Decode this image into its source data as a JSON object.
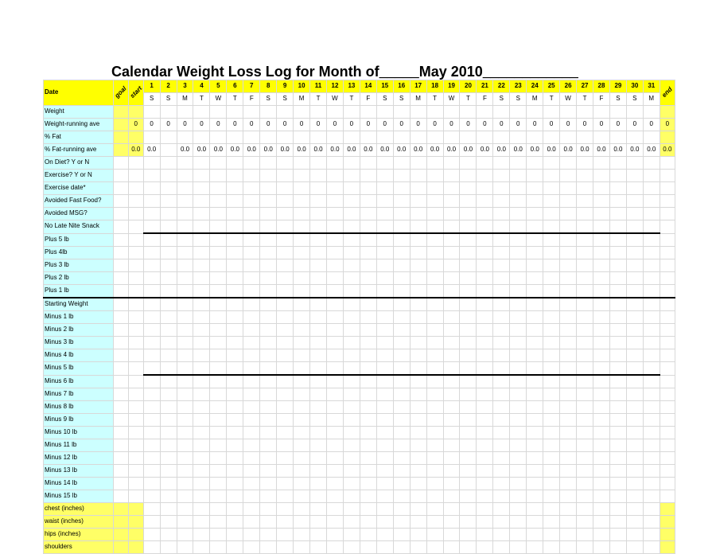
{
  "title_prefix": "Calendar Weight Loss Log for Month of",
  "title_blank": "_____",
  "title_month": "May 2010",
  "title_suffix": "____________",
  "header": {
    "date_label": "Date",
    "goal": "goal",
    "start": "start",
    "end": "end",
    "days": [
      "1",
      "2",
      "3",
      "4",
      "5",
      "6",
      "7",
      "8",
      "9",
      "10",
      "11",
      "12",
      "13",
      "14",
      "15",
      "16",
      "17",
      "18",
      "19",
      "20",
      "21",
      "22",
      "23",
      "24",
      "25",
      "26",
      "27",
      "28",
      "29",
      "30",
      "31"
    ],
    "dows": [
      "S",
      "S",
      "M",
      "T",
      "W",
      "T",
      "F",
      "S",
      "S",
      "M",
      "T",
      "W",
      "T",
      "F",
      "S",
      "S",
      "M",
      "T",
      "W",
      "T",
      "F",
      "S",
      "S",
      "M",
      "T",
      "W",
      "T",
      "F",
      "S",
      "S",
      "M"
    ]
  },
  "rows": {
    "weight": "Weight",
    "weight_run": {
      "label": "Weight-running ave",
      "start": "0",
      "vals": [
        "0",
        "0",
        "0",
        "0",
        "0",
        "0",
        "0",
        "0",
        "0",
        "0",
        "0",
        "0",
        "0",
        "0",
        "0",
        "0",
        "0",
        "0",
        "0",
        "0",
        "0",
        "0",
        "0",
        "0",
        "0",
        "0",
        "0",
        "0",
        "0",
        "0",
        "0"
      ],
      "end": "0"
    },
    "pct_fat": "% Fat",
    "fat_run": {
      "label": "% Fat-running ave",
      "start": "0.0",
      "vals": [
        "0.0",
        "",
        "0.0",
        "0.0",
        "0.0",
        "0.0",
        "0.0",
        "0.0",
        "0.0",
        "0.0",
        "0.0",
        "0.0",
        "0.0",
        "0.0",
        "0.0",
        "0.0",
        "0.0",
        "0.0",
        "0.0",
        "0.0",
        "0.0",
        "0.0",
        "0.0",
        "0.0",
        "0.0",
        "0.0",
        "0.0",
        "0.0",
        "0.0",
        "0.0",
        "0.0"
      ],
      "end": "0.0"
    },
    "on_diet": "On Diet? Y or N",
    "exercise": "Exercise? Y or N",
    "exercise_date": "Exercise date*",
    "avoid_ff": "Avoided Fast Food?",
    "avoid_msg": "Avoided MSG?",
    "no_late": "No Late Nite Snack",
    "plus": [
      "Plus 5 lb",
      "Plus 4lb",
      "Plus 3 lb",
      "Plus 2 lb",
      "Plus 1 lb"
    ],
    "starting": "Starting Weight",
    "minus": [
      "Minus 1 lb",
      "Minus 2 lb",
      "Minus 3 lb",
      "Minus 4 lb",
      "Minus 5 lb",
      "Minus 6 lb",
      "Minus 7 lb",
      "Minus 8 lb",
      "Minus 9 lb",
      "Minus 10 lb",
      "Minus 11 lb",
      "Minus 12 lb",
      "Minus 13 lb",
      "Minus 14 lb",
      "Minus 15 lb"
    ],
    "measurements": [
      "chest (inches)",
      "waist (inches)",
      "hips (inches)",
      "shoulders"
    ]
  }
}
